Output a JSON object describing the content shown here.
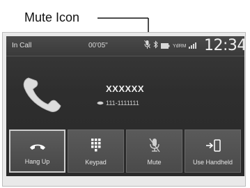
{
  "callout": {
    "label": "Mute Icon"
  },
  "status_bar": {
    "title": "In Call",
    "timer": "00'05\"",
    "clock": "12:34",
    "icons": [
      "mic-muted-icon",
      "bluetooth-icon",
      "battery-icon",
      "signal-icon",
      "roaming-icon"
    ],
    "roaming_text": "Yd",
    "roaming_text2": "RM"
  },
  "call": {
    "caller_name": "XXXXXX",
    "caller_number": "111-1111111",
    "number_type_icon": "mobile-phone-icon"
  },
  "buttons": [
    {
      "label": "Hang Up",
      "icon": "hang-up-icon",
      "selected": true
    },
    {
      "label": "Keypad",
      "icon": "keypad-icon",
      "selected": false
    },
    {
      "label": "Mute",
      "icon": "mic-mute-icon",
      "selected": false
    },
    {
      "label": "Use Handheld",
      "icon": "transfer-handheld-icon",
      "selected": false
    }
  ],
  "colors": {
    "screen_bg": "#2e2e2e",
    "button_bg": "#4f4f4f",
    "text": "#e8e8e8",
    "page_bg": "#ffffff",
    "panel_bg": "#e9e9e9"
  }
}
